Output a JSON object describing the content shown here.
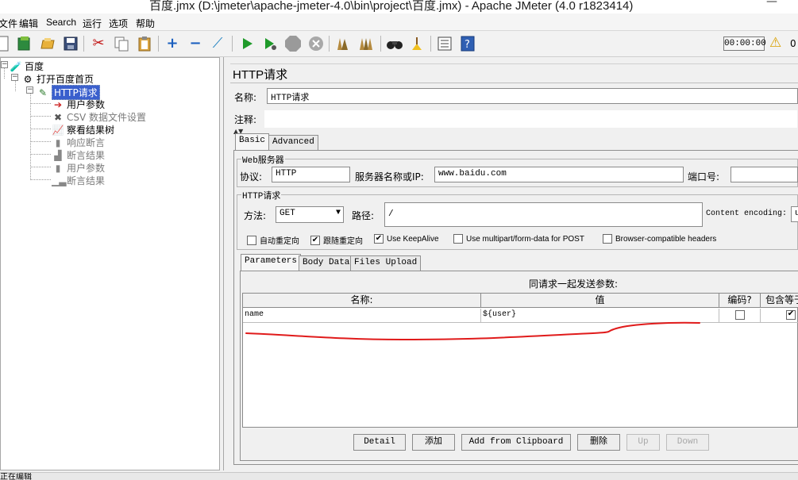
{
  "window": {
    "title": "百度.jmx (D:\\jmeter\\apache-jmeter-4.0\\bin\\project\\百度.jmx) - Apache JMeter (4.0 r1823414)",
    "minimize": "—"
  },
  "menu": [
    "文件",
    "编辑",
    "Search",
    "运行",
    "选项",
    "帮助"
  ],
  "toolbar": {
    "timer": "00:00:00",
    "warning_count": "0"
  },
  "tree": {
    "root": "百度",
    "thread_group": "打开百度首页",
    "sampler": "HTTP请求",
    "children": [
      "用户参数",
      "CSV 数据文件设置",
      "察看结果树",
      "响应断言",
      "断言结果",
      "用户参数",
      "断言结果"
    ]
  },
  "panel": {
    "title": "HTTP请求",
    "name_label": "名称:",
    "name_value": "HTTP请求",
    "comment_label": "注释:",
    "tabs": [
      "Basic",
      "Advanced"
    ],
    "web_server": {
      "title": "Web服务器",
      "protocol_label": "协议:",
      "protocol_value": "HTTP",
      "server_label": "服务器名称或IP:",
      "server_value": "www.baidu.com",
      "port_label": "端口号:",
      "port_value": ""
    },
    "http_request": {
      "title": "HTTP请求",
      "method_label": "方法:",
      "method_value": "GET",
      "path_label": "路径:",
      "path_value": "/",
      "encoding_label": "Content encoding:",
      "encoding_value": "u"
    },
    "options": [
      {
        "label": "自动重定向",
        "checked": false
      },
      {
        "label": "跟随重定向",
        "checked": true
      },
      {
        "label": "Use KeepAlive",
        "checked": true
      },
      {
        "label": "Use multipart/form-data for POST",
        "checked": false
      },
      {
        "label": "Browser-compatible headers",
        "checked": false
      }
    ],
    "subtabs": [
      "Parameters",
      "Body Data",
      "Files Upload"
    ],
    "params_title": "同请求一起发送参数:",
    "table_headers": [
      "名称:",
      "值",
      "编码?",
      "包含等于"
    ],
    "table_rows": [
      {
        "name": "name",
        "value": "${user}",
        "encode": false,
        "include_equals": true
      }
    ],
    "buttons": [
      "Detail",
      "添加",
      "Add from Clipboard",
      "删除",
      "Up",
      "Down"
    ]
  },
  "status": "正在编辑",
  "colors": {
    "selection": "#3a5fcd",
    "annotation": "#e01b1b"
  }
}
